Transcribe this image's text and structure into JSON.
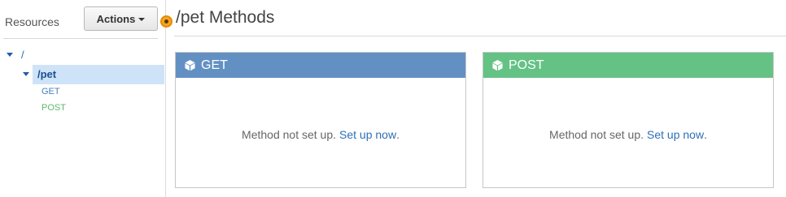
{
  "sidebar": {
    "resources_label": "Resources",
    "actions_label": "Actions",
    "tree": {
      "root": "/",
      "pet": "/pet",
      "methods": [
        "GET",
        "POST"
      ]
    }
  },
  "main": {
    "title": "/pet Methods",
    "cards": [
      {
        "method": "GET",
        "message": "Method not set up.",
        "link": "Set up now",
        "punct": "."
      },
      {
        "method": "POST",
        "message": "Method not set up.",
        "link": "Set up now",
        "punct": "."
      }
    ]
  },
  "icons": {
    "cube": "cube-icon",
    "caret": "caret-down-icon",
    "drag": "drag-handle-icon"
  },
  "colors": {
    "get_header": "#6390c3",
    "post_header": "#65c285",
    "link": "#2d6fb7",
    "selected_row": "#cfe3f8",
    "drag_dot": "#f5a623"
  }
}
